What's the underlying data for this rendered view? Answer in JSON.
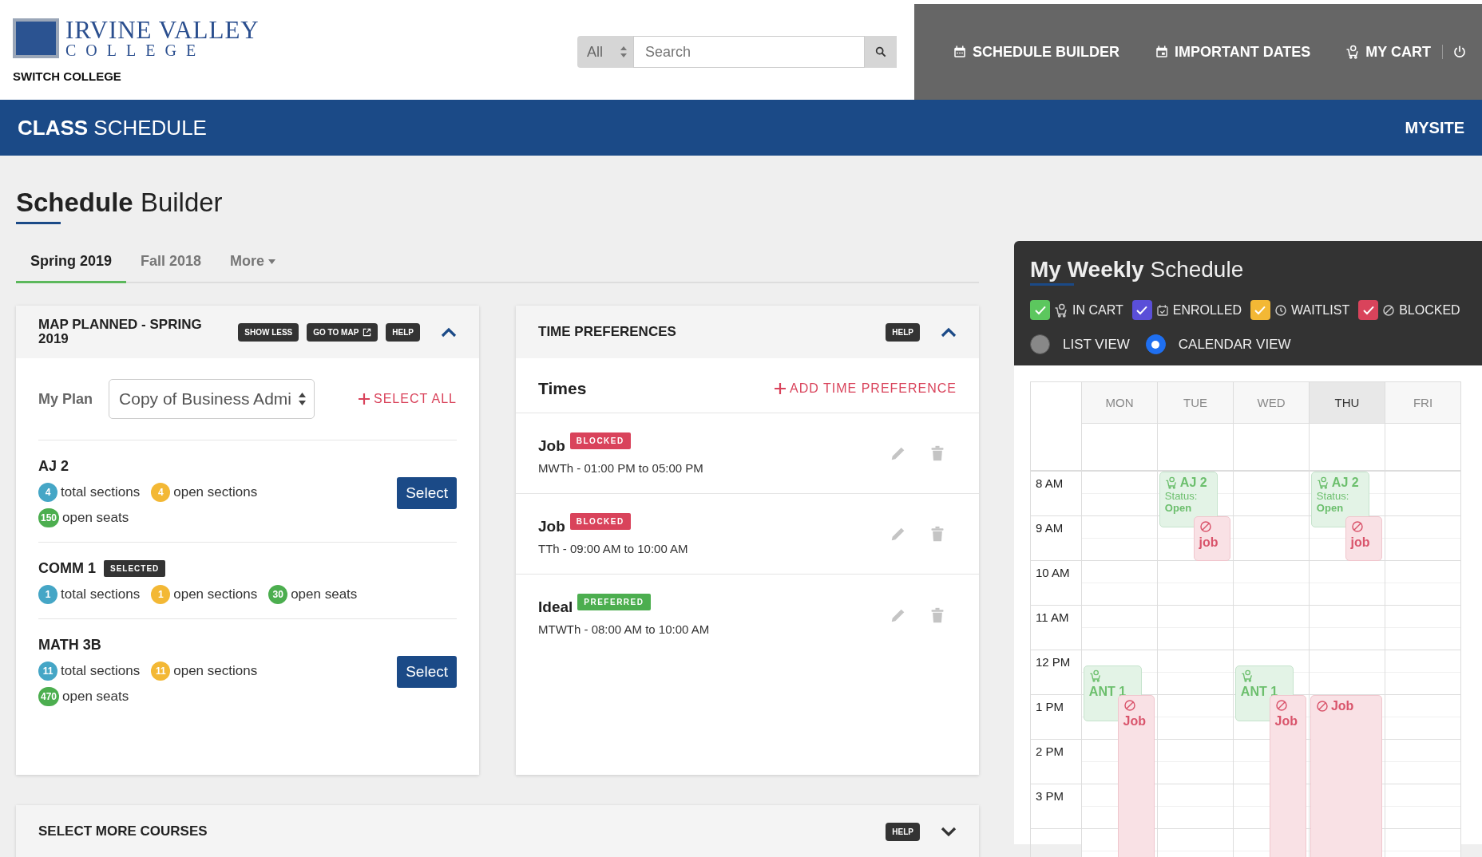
{
  "header": {
    "logo": {
      "line1": "IRVINE VALLEY",
      "line2": "COLLEGE"
    },
    "switch_link": "SWITCH COLLEGE",
    "search": {
      "scope": "All",
      "placeholder": "Search"
    },
    "nav": [
      {
        "label": "SCHEDULE BUILDER",
        "kind": "schedule"
      },
      {
        "label": "IMPORTANT DATES",
        "kind": "dates"
      },
      {
        "label": "MY CART",
        "kind": "cart"
      }
    ]
  },
  "banner": {
    "title": "**CLASS** SCHEDULE",
    "link": "MYSITE"
  },
  "page_title": "**Schedule** Builder",
  "tabs": [
    {
      "label": "Spring 2019",
      "selected": true,
      "kind": "tab"
    },
    {
      "label": "Fall 2018",
      "selected": false,
      "kind": "tab"
    },
    {
      "label": "More",
      "selected": false,
      "kind": "menu"
    }
  ],
  "map_card": {
    "title": "MAP PLANNED - SPRING 2019",
    "expanded": true,
    "buttons": [
      {
        "label": "SHOW LESS",
        "kind": "plain"
      },
      {
        "label": "GO TO MAP",
        "kind": "external"
      },
      {
        "label": "HELP",
        "kind": "plain"
      }
    ],
    "plan_label": "My Plan",
    "plan_value": "Copy of Business Admi",
    "select_all": "SELECT ALL",
    "courses": [
      {
        "name": "AJ 2",
        "action": "Select",
        "stats": [
          {
            "count": "4",
            "label": "total sections",
            "color": "#45a6c6"
          },
          {
            "count": "4",
            "label": "open sections",
            "color": "#f3b835"
          },
          {
            "count": "150",
            "label": "open seats",
            "color": "#4cae4f"
          }
        ]
      },
      {
        "name": "COMM 1",
        "tag": "SELECTED",
        "stats": [
          {
            "count": "1",
            "label": "total sections",
            "color": "#45a6c6"
          },
          {
            "count": "1",
            "label": "open sections",
            "color": "#f3b835"
          },
          {
            "count": "30",
            "label": "open seats",
            "color": "#4cae4f"
          }
        ]
      },
      {
        "name": "MATH 3B",
        "action": "Select",
        "stats": [
          {
            "count": "11",
            "label": "total sections",
            "color": "#45a6c6"
          },
          {
            "count": "11",
            "label": "open sections",
            "color": "#f3b835"
          },
          {
            "count": "470",
            "label": "open seats",
            "color": "#4cae4f"
          }
        ]
      }
    ]
  },
  "time_card": {
    "title": "TIME PREFERENCES",
    "help": "HELP",
    "expanded": true,
    "subtitle": "Times",
    "add_link": "ADD TIME PREFERENCE",
    "items": [
      {
        "name": "Job",
        "tag": "BLOCKED",
        "kind": "blocked",
        "schedule": "MWTh - 01:00 PM to 05:00 PM"
      },
      {
        "name": "Job",
        "tag": "BLOCKED",
        "kind": "blocked",
        "schedule": "TTh - 09:00 AM to 10:00 AM"
      },
      {
        "name": "Ideal",
        "tag": "PREFERRED",
        "kind": "preferred",
        "schedule": "MTWTh - 08:00 AM to 10:00 AM"
      }
    ]
  },
  "more_card": {
    "title": "SELECT MORE COURSES",
    "help": "HELP",
    "expanded": false
  },
  "weekly": {
    "title": "**My Weekly** Schedule",
    "legend": [
      {
        "label": "IN CART",
        "checked": true,
        "color": "#5cc75e",
        "kind": "cart"
      },
      {
        "label": "ENROLLED",
        "checked": true,
        "color": "#5a4fd8",
        "kind": "enrolled"
      },
      {
        "label": "WAITLIST",
        "checked": true,
        "color": "#f3b835",
        "kind": "waitlist"
      },
      {
        "label": "BLOCKED",
        "checked": true,
        "color": "#d9435b",
        "kind": "blocked"
      }
    ],
    "views": [
      {
        "label": "LIST VIEW",
        "selected": false
      },
      {
        "label": "CALENDAR VIEW",
        "selected": true
      }
    ],
    "calendar": {
      "hours": [
        "8 AM",
        "9 AM",
        "10 AM",
        "11 AM",
        "12 PM",
        "1 PM",
        "2 PM",
        "3 PM"
      ],
      "days": [
        {
          "label": "MON",
          "selected": false,
          "events": [
            {
              "kind": "in_cart",
              "title": "ANT 1"
            },
            {
              "kind": "blocked",
              "title": "Job"
            }
          ]
        },
        {
          "label": "TUE",
          "selected": false,
          "events": [
            {
              "kind": "in_cart",
              "title": "AJ 2",
              "status_label": "Status:",
              "status": "Open"
            },
            {
              "kind": "blocked",
              "title": "job"
            }
          ]
        },
        {
          "label": "WED",
          "selected": false,
          "events": [
            {
              "kind": "in_cart",
              "title": "ANT 1"
            },
            {
              "kind": "blocked",
              "title": "Job"
            }
          ]
        },
        {
          "label": "THU",
          "selected": true,
          "events": [
            {
              "kind": "in_cart",
              "title": "AJ 2",
              "status_label": "Status:",
              "status": "Open"
            },
            {
              "kind": "blocked",
              "title": "job"
            },
            {
              "kind": "blocked",
              "title": "Job"
            }
          ]
        },
        {
          "label": "FRI",
          "selected": false
        }
      ]
    }
  }
}
